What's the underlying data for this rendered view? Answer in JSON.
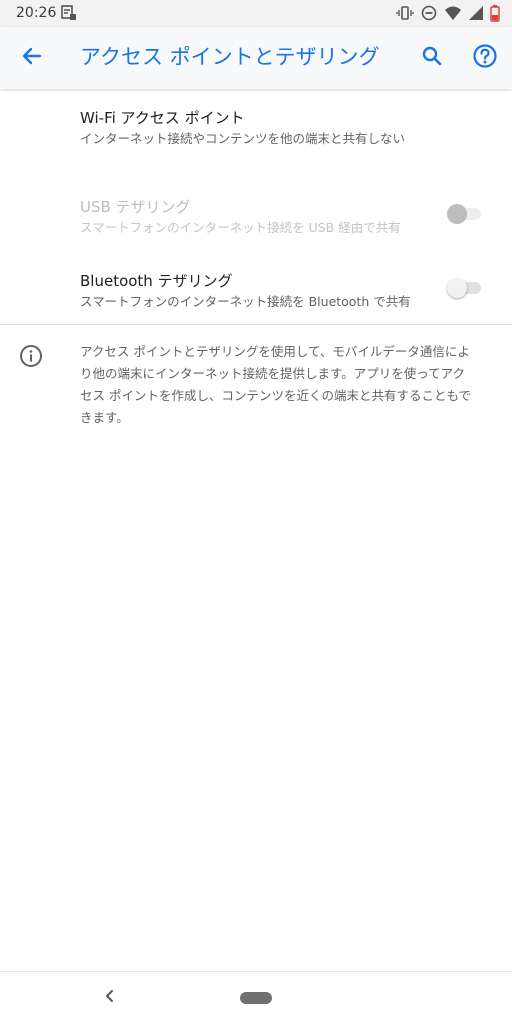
{
  "status_bar": {
    "time": "20:26",
    "icons": [
      "notification-icon",
      "vibrate-icon",
      "do-not-disturb-icon",
      "wifi-icon",
      "signal-icon",
      "battery-low-icon"
    ],
    "battery_color": "#e53935"
  },
  "app_bar": {
    "title": "アクセス ポイントとテザリング",
    "accent_color": "#1a73e8",
    "back_icon": "arrow-back-icon",
    "search_icon": "search-icon",
    "help_icon": "help-icon"
  },
  "preferences": [
    {
      "title": "Wi-Fi アクセス ポイント",
      "summary": "インターネット接続やコンテンツを他の端末と共有しない",
      "has_toggle": false,
      "enabled": true
    },
    {
      "title": "USB テザリング",
      "summary": "スマートフォンのインターネット接続を USB 経由で共有",
      "has_toggle": true,
      "toggle_on": false,
      "enabled": false
    },
    {
      "title": "Bluetooth テザリング",
      "summary": "スマートフォンのインターネット接続を Bluetooth で共有",
      "has_toggle": true,
      "toggle_on": false,
      "enabled": true
    }
  ],
  "footer_info": {
    "icon": "info-icon",
    "lines": [
      "アクセス ポイントとテザリングを使用して、モバイルデータ通信によ",
      "り他の端末にインターネット接続を提供します。アプリを使ってアク",
      "セス ポイントを作成し、コンテンツを近くの端末と共有することもで",
      "きます。"
    ]
  },
  "nav_bar": {
    "back_icon": "nav-back-icon",
    "home_icon": "home-pill-icon"
  }
}
